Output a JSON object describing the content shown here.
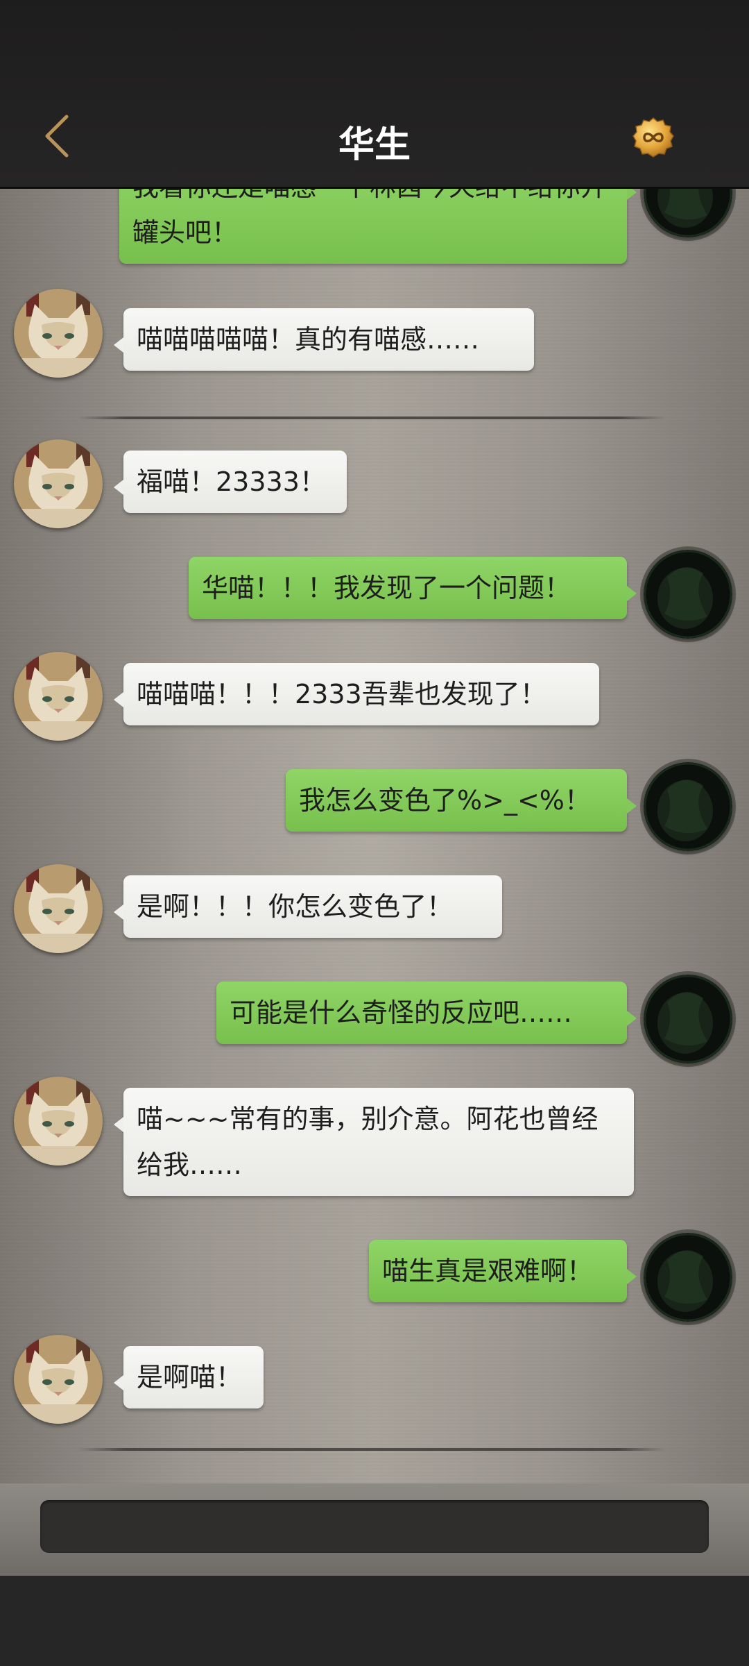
{
  "header": {
    "title": "华生",
    "back_icon": "chevron-left-icon",
    "badge_icon": "infinity-coin-icon",
    "accent_color": "#b8935a"
  },
  "messages": [
    {
      "side": "right",
      "text": "我看你还是喵感一下林茜今天给不给你开罐头吧！"
    },
    {
      "side": "left",
      "text": "喵喵喵喵喵！真的有喵感……"
    },
    {
      "side": "left",
      "text": "福喵！23333！"
    },
    {
      "side": "right",
      "text": "华喵！！！我发现了一个问题！"
    },
    {
      "side": "left",
      "text": "喵喵喵！！！2333吾辈也发现了！"
    },
    {
      "side": "right",
      "text": "我怎么变色了%>_<%！"
    },
    {
      "side": "left",
      "text": "是啊！！！你怎么变色了！"
    },
    {
      "side": "right",
      "text": "可能是什么奇怪的反应吧……"
    },
    {
      "side": "left",
      "text": "喵~~~常有的事，别介意。阿花也曾经给我……"
    },
    {
      "side": "right",
      "text": "喵生真是艰难啊！"
    },
    {
      "side": "left",
      "text": "是啊喵！"
    }
  ],
  "input": {
    "value": "",
    "placeholder": ""
  },
  "colors": {
    "self_bubble": "#82c85a",
    "other_bubble": "#efefed",
    "header_bg": "#1f1e1e"
  }
}
